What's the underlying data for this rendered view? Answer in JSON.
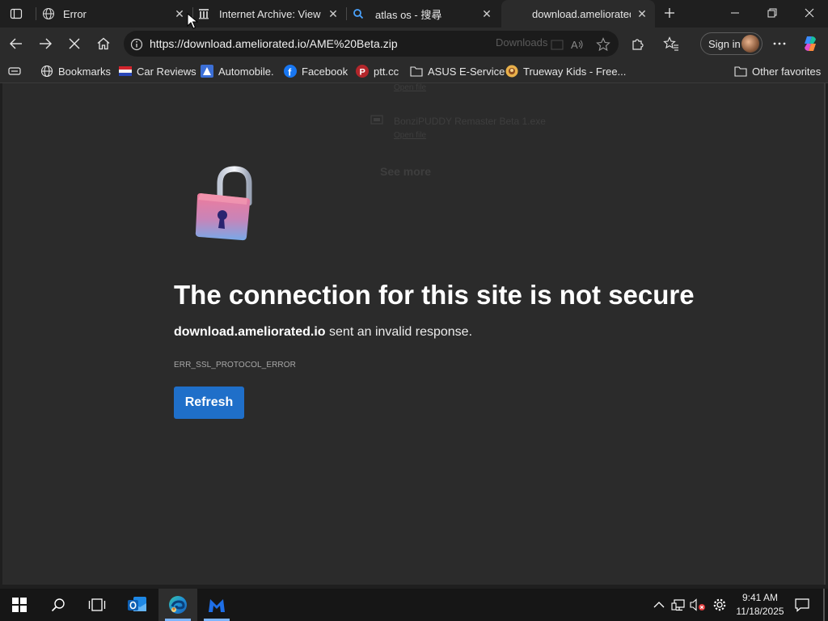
{
  "tabs": [
    {
      "title": "Error",
      "icon": "globe-icon",
      "active": false
    },
    {
      "title": "Internet Archive: View Ar",
      "icon": "archive-icon",
      "active": false
    },
    {
      "title": "atlas os - 搜尋",
      "icon": "search-icon",
      "active": false
    },
    {
      "title": "download.ameliorated.io",
      "icon": "loading-icon",
      "active": true
    }
  ],
  "address_bar": {
    "url": "https://download.ameliorated.io/AME%20Beta.zip",
    "ghost_downloads_label": "Downloads"
  },
  "toolbar": {
    "sign_in_label": "Sign in"
  },
  "bookmarks": [
    {
      "label": "Bookmarks",
      "icon": "globe-icon"
    },
    {
      "label": "Car Reviews",
      "icon": "flag-icon"
    },
    {
      "label": "Automobile.",
      "icon": "triangle-icon"
    },
    {
      "label": "Facebook",
      "icon": "facebook-icon"
    },
    {
      "label": "ptt.cc",
      "icon": "ptt-icon"
    },
    {
      "label": "ASUS E-Service",
      "icon": "folder-icon"
    },
    {
      "label": "Trueway Kids - Free...",
      "icon": "trueway-icon"
    },
    {
      "label": "Other favorites",
      "icon": "folder-icon"
    }
  ],
  "ghost_downloads": {
    "open_file_1": "Open file",
    "item_2": "BonziPUDDY Remaster Beta 1.exe",
    "open_file_2": "Open file",
    "see_more": "See more"
  },
  "error_page": {
    "title": "The connection for this site is not secure",
    "host": "download.ameliorated.io",
    "message": " sent an invalid response.",
    "error_code": "ERR_SSL_PROTOCOL_ERROR",
    "refresh_label": "Refresh"
  },
  "taskbar": {
    "time": "9:41 AM",
    "date": "11/18/2025"
  },
  "colors": {
    "accent": "#1f6fc9",
    "background": "#2b2b2b"
  }
}
